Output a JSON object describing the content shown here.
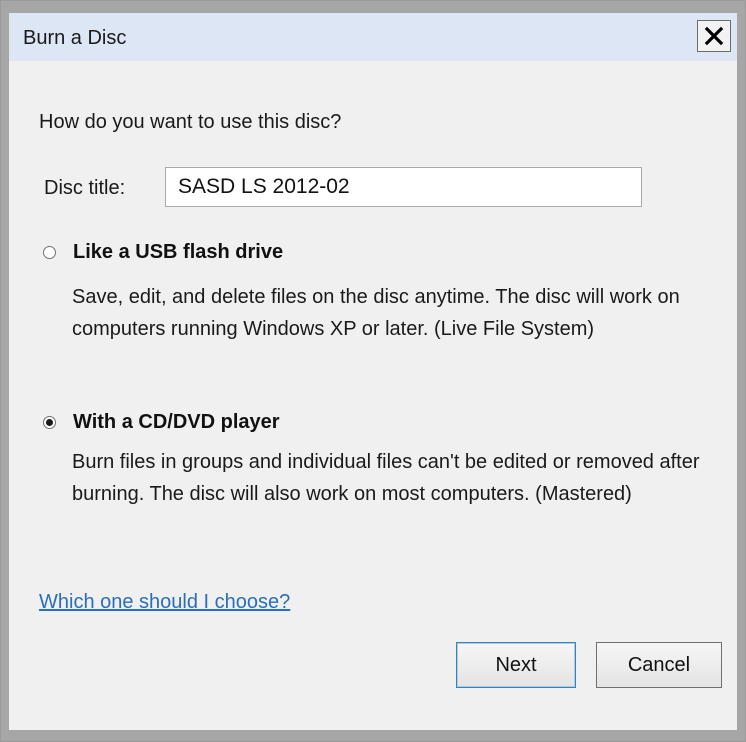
{
  "window": {
    "title": "Burn a Disc",
    "close_symbol": "close-icon"
  },
  "dialog": {
    "question": "How do you want to use this disc?",
    "disc_title_label": "Disc title:",
    "disc_title_value": "SASD LS 2012-02"
  },
  "options": [
    {
      "label": "Like a USB flash drive",
      "description": "Save, edit, and delete files on the disc anytime. The disc will work on computers running Windows XP or later. (Live File System)",
      "selected": false
    },
    {
      "label": "With a CD/DVD player",
      "description": "Burn files in groups and individual files can't be edited or removed after burning. The disc will also work on most computers. (Mastered)",
      "selected": true
    }
  ],
  "help_link": "Which one should I choose?",
  "buttons": {
    "next": "Next",
    "cancel": "Cancel"
  },
  "colors": {
    "titlebar": "#dce6f4",
    "content_bg": "#f0f0f0",
    "link": "#2a6ebd"
  }
}
